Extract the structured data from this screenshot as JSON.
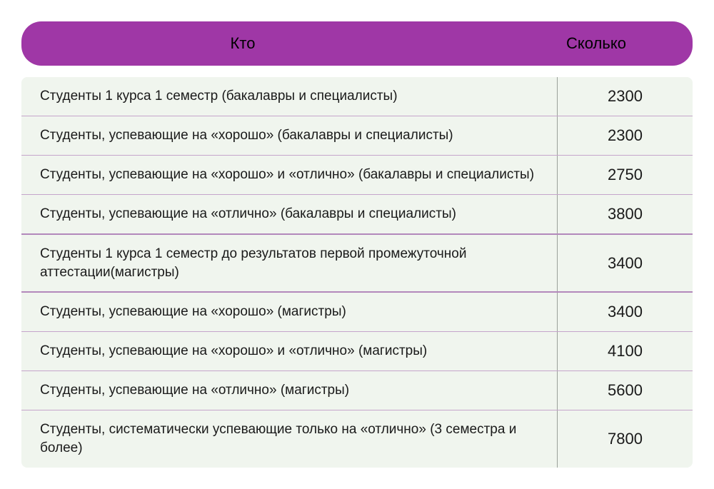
{
  "header": {
    "who_label": "Кто",
    "amount_label": "Сколько"
  },
  "rows": [
    {
      "who": "Студенты 1 курса 1 семестр (бакалавры и специалисты)",
      "amount": "2300",
      "section_end": false
    },
    {
      "who": "Студенты, успевающие на «хорошо» (бакалавры и специалисты)",
      "amount": "2300",
      "section_end": false
    },
    {
      "who": "Студенты, успевающие на «хорошо» и «отлично» (бакалавры и специалисты)",
      "amount": "2750",
      "section_end": false
    },
    {
      "who": "Студенты, успевающие на «отлично» (бакалавры и специалисты)",
      "amount": "3800",
      "section_end": true
    },
    {
      "who": "Студенты 1 курса 1 семестр до результатов первой промежуточной аттестации(магистры)",
      "amount": "3400",
      "section_end": true
    },
    {
      "who": "Студенты, успевающие на «хорошо» (магистры)",
      "amount": "3400",
      "section_end": false
    },
    {
      "who": "Студенты, успевающие на «хорошо» и «отлично» (магистры)",
      "amount": "4100",
      "section_end": false
    },
    {
      "who": "Студенты, успевающие на «отлично» (магистры)",
      "amount": "5600",
      "section_end": false
    },
    {
      "who": "Студенты, систематически успевающие только на «отлично» (3 семестра и более)",
      "amount": "7800",
      "section_end": false
    }
  ]
}
